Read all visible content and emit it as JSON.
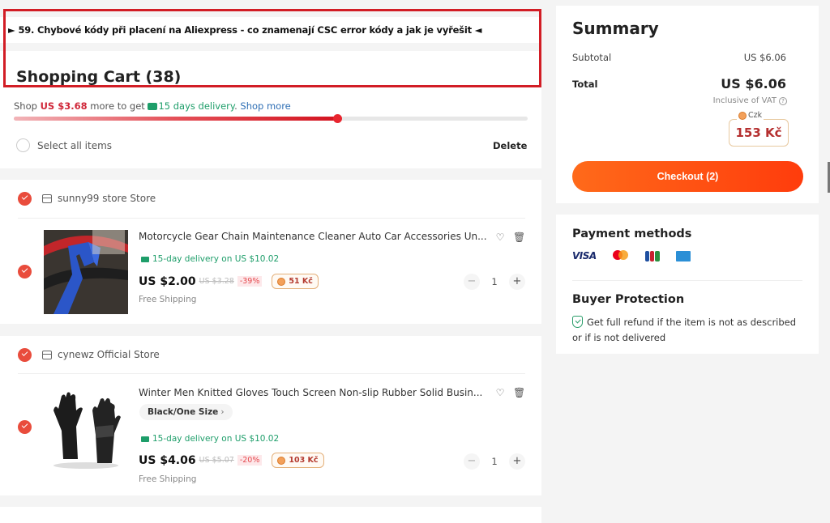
{
  "banner": {
    "text": "► 59. Chybové kódy při placení na Aliexpress - co znamenají CSC error kódy a jak je vyřešit ◄"
  },
  "cart": {
    "title": "Shopping Cart (38)",
    "promo": {
      "prefix": "Shop ",
      "amount": "US $3.68",
      "middle": " more to get ",
      "delivery": "15 days delivery",
      "period": ". ",
      "shop_more": "Shop more"
    },
    "progress_fraction": 0.63,
    "select_all_label": "Select all items",
    "delete_label": "Delete"
  },
  "stores": [
    {
      "name": "sunny99 store Store",
      "items": [
        {
          "title": "Motorcycle Gear Chain Maintenance Cleaner Auto Car Accessories Un...",
          "sku": "",
          "delivery": "15-day delivery on US $10.02",
          "price": "US $2.00",
          "old_price": "US $3.28",
          "discount": "-39%",
          "coins": "51 Kč",
          "shipping": "Free Shipping",
          "quantity": "1"
        }
      ]
    },
    {
      "name": "cynewz Official Store",
      "items": [
        {
          "title": "Winter Men Knitted Gloves Touch Screen Non-slip Rubber Solid Busin...",
          "sku": "Black/One Size",
          "delivery": "15-day delivery on US $10.02",
          "price": "US $4.06",
          "old_price": "US $5.07",
          "discount": "-20%",
          "coins": "103 Kč",
          "shipping": "Free Shipping",
          "quantity": "1"
        }
      ]
    }
  ],
  "summary": {
    "title": "Summary",
    "subtotal_label": "Subtotal",
    "subtotal_value": "US $6.06",
    "total_label": "Total",
    "total_value": "US $6.06",
    "vat_note": "Inclusive of VAT",
    "currency_label": "Czk",
    "currency_value": "153 Kč",
    "checkout_label": "Checkout (2)"
  },
  "payments": {
    "title": "Payment methods",
    "methods": [
      "visa",
      "mastercard",
      "jcb",
      "amex"
    ],
    "visa_text": "VISA"
  },
  "buyer_protection": {
    "title": "Buyer Protection",
    "text": "Get full refund if the item is not as described or if is not delivered"
  },
  "colors": {
    "accent_red": "#d21d25",
    "checkout_orange": "#ff5414",
    "delivery_green": "#1e9e6a",
    "link_blue": "#2f6fb5"
  }
}
